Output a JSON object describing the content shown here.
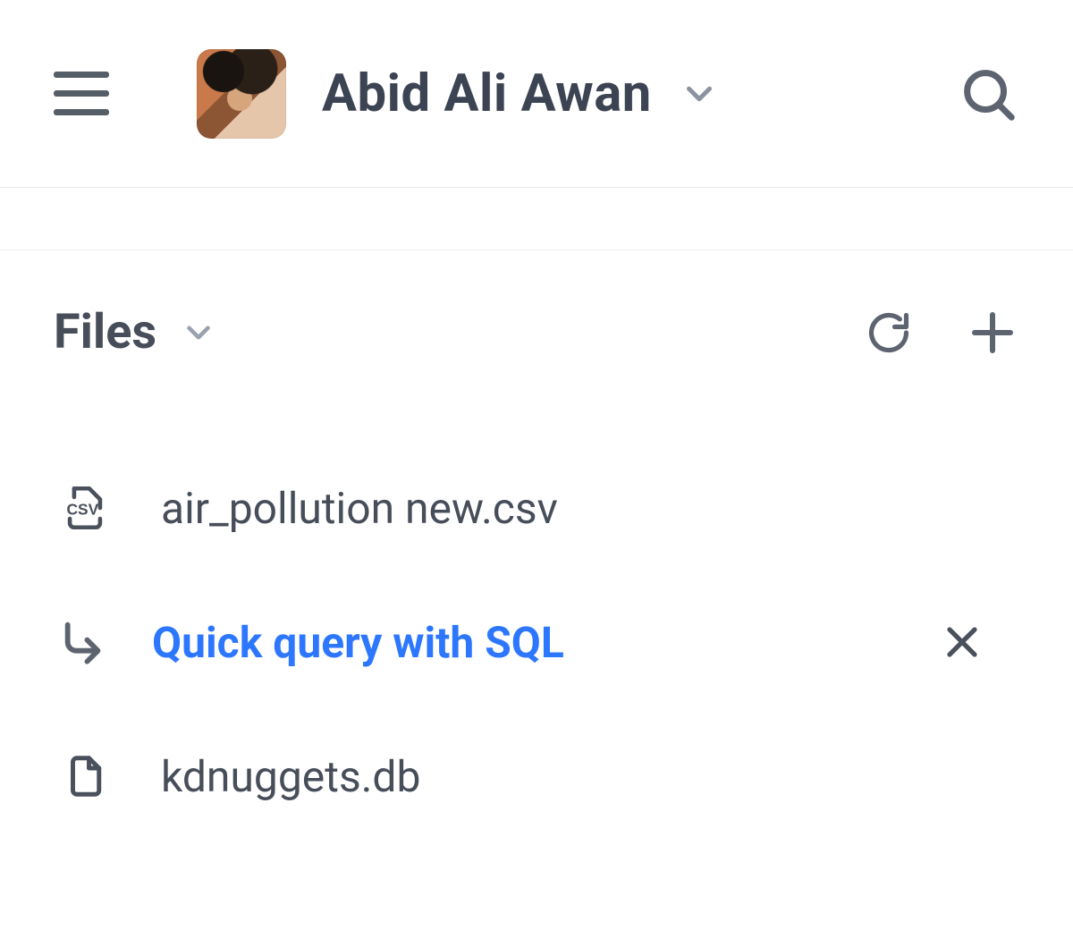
{
  "header": {
    "username": "Abid Ali Awan"
  },
  "files": {
    "title": "Files",
    "items": [
      {
        "name": "air_pollution new.csv",
        "icon": "csv"
      },
      {
        "name": "Quick query with SQL",
        "icon": "reply",
        "highlight": true,
        "closable": true
      },
      {
        "name": "kdnuggets.db",
        "icon": "file"
      }
    ]
  }
}
